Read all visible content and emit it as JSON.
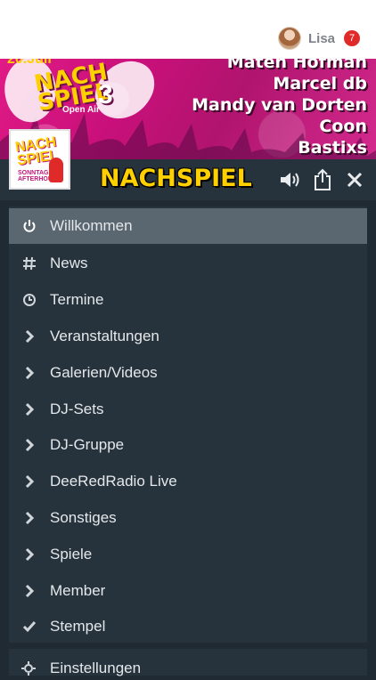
{
  "user": {
    "name": "Lisa",
    "notifications": "7"
  },
  "banner": {
    "date_fragment": "20.Juli",
    "event_title": "NACH SPIEL",
    "edition": "3",
    "subtitle": "Open Air",
    "lineup": [
      "Maten Hofman",
      "Marcel db",
      "Mandy van Dorten",
      "Coon",
      "Bastixs"
    ],
    "logo_text": "NACH SPIEL",
    "logo_subtext": "SONNTAGS AFTERHOUR"
  },
  "header": {
    "brand": "NACHSPIEL",
    "brand_color": "#ffd000"
  },
  "menu": {
    "items": [
      {
        "label": "Willkommen",
        "icon": "power-icon",
        "active": true
      },
      {
        "label": "News",
        "icon": "hash-icon"
      },
      {
        "label": "Termine",
        "icon": "clock-icon"
      },
      {
        "label": "Veranstaltungen",
        "icon": "chevron-right-icon"
      },
      {
        "label": "Galerien/Videos",
        "icon": "chevron-right-icon"
      },
      {
        "label": "DJ-Sets",
        "icon": "chevron-right-icon"
      },
      {
        "label": "DJ-Gruppe",
        "icon": "chevron-right-icon"
      },
      {
        "label": "DeeRedRadio Live",
        "icon": "chevron-right-icon"
      },
      {
        "label": "Sonstiges",
        "icon": "chevron-right-icon"
      },
      {
        "label": "Spiele",
        "icon": "chevron-right-icon"
      },
      {
        "label": "Member",
        "icon": "chevron-right-icon"
      },
      {
        "label": "Stempel",
        "icon": "check-icon"
      }
    ],
    "bottom_item": {
      "label": "Einstellungen",
      "icon": "gear-icon"
    }
  }
}
